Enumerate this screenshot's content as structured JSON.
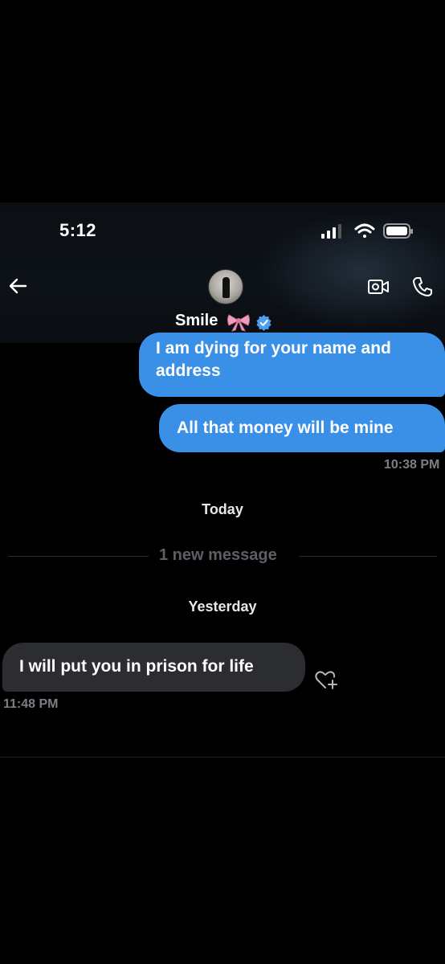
{
  "status_bar": {
    "time": "5:12"
  },
  "header": {
    "contact_name": "Smile",
    "icons": {
      "back": "back-arrow-icon",
      "video": "video-call-icon",
      "phone": "phone-icon",
      "verified": "verified-badge-icon",
      "bow": "pink-bow-emoji"
    }
  },
  "messages": [
    {
      "direction": "outgoing",
      "text_line1": "I am dying for your name and",
      "text_line2": "address"
    },
    {
      "direction": "outgoing",
      "text": "All that money will be mine"
    }
  ],
  "timestamps": {
    "outgoing_last": "10:38 PM",
    "incoming_last": "11:48 PM"
  },
  "separators": {
    "today": "Today",
    "new_message": "1 new message",
    "yesterday": "Yesterday"
  },
  "incoming": {
    "text": "I will put you in prison for life"
  },
  "colors": {
    "outgoing_bubble": "#3a8fe6",
    "incoming_bubble": "#2b2d31",
    "verified": "#4a9ff0",
    "bow": "#f19bbd"
  }
}
